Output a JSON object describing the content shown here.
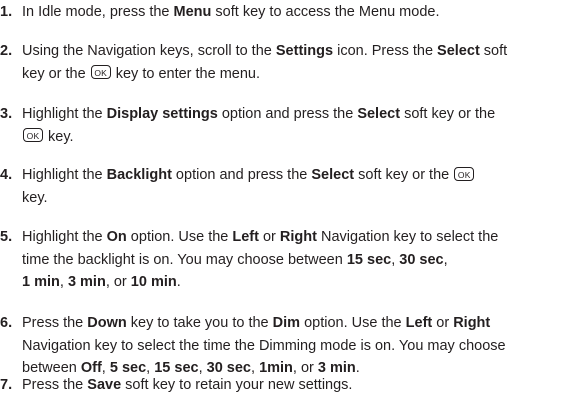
{
  "steps": [
    {
      "num": "1.",
      "lines": [
        [
          {
            "t": "In Idle mode, press the "
          },
          {
            "b": "Menu"
          },
          {
            "t": " soft key to access the Menu mode."
          }
        ]
      ]
    },
    {
      "num": "2.",
      "lines": [
        [
          {
            "t": "Using the Navigation keys, scroll to the "
          },
          {
            "b": "Settings"
          },
          {
            "t": " icon. Press the "
          },
          {
            "b": "Select"
          },
          {
            "t": " soft"
          }
        ],
        [
          {
            "t": "key or the "
          },
          {
            "k": "OK"
          },
          {
            "t": " key to enter the menu."
          }
        ]
      ]
    },
    {
      "num": "3.",
      "lines": [
        [
          {
            "t": "Highlight the "
          },
          {
            "b": "Display settings"
          },
          {
            "t": " option and press the "
          },
          {
            "b": "Select"
          },
          {
            "t": " soft key or the"
          }
        ],
        [
          {
            "k": "OK"
          },
          {
            "t": " key."
          }
        ]
      ]
    },
    {
      "num": "4.",
      "lines": [
        [
          {
            "t": "Highlight the "
          },
          {
            "b": "Backlight"
          },
          {
            "t": " option and press the "
          },
          {
            "b": "Select"
          },
          {
            "t": " soft key or the "
          },
          {
            "k": "OK"
          }
        ],
        [
          {
            "t": "key."
          }
        ]
      ]
    },
    {
      "num": "5.",
      "lines": [
        [
          {
            "t": "Highlight the "
          },
          {
            "b": "On"
          },
          {
            "t": " option. Use the "
          },
          {
            "b": "Left"
          },
          {
            "t": " or "
          },
          {
            "b": "Right"
          },
          {
            "t": " Navigation key to select the"
          }
        ],
        [
          {
            "t": "time the backlight is on. You may choose between "
          },
          {
            "b": "15 sec"
          },
          {
            "t": ", "
          },
          {
            "b": "30 sec"
          },
          {
            "t": ","
          }
        ],
        [
          {
            "b": "1 min"
          },
          {
            "t": ", "
          },
          {
            "b": "3 min"
          },
          {
            "t": ", or "
          },
          {
            "b": "10 min"
          },
          {
            "t": "."
          }
        ]
      ]
    },
    {
      "num": "6.",
      "lines": [
        [
          {
            "t": "Press the "
          },
          {
            "b": "Down"
          },
          {
            "t": " key to take you to the "
          },
          {
            "b": "Dim"
          },
          {
            "t": " option. Use the "
          },
          {
            "b": "Left"
          },
          {
            "t": " or "
          },
          {
            "b": "Right"
          }
        ],
        [
          {
            "t": "Navigation key to select the time the Dimming mode is on. You may choose"
          }
        ],
        [
          {
            "t": "between "
          },
          {
            "b": "Off"
          },
          {
            "t": ", "
          },
          {
            "b": "5 sec"
          },
          {
            "t": ", "
          },
          {
            "b": "15 sec"
          },
          {
            "t": ", "
          },
          {
            "b": "30 sec"
          },
          {
            "t": ", "
          },
          {
            "b": "1min"
          },
          {
            "t": ", or "
          },
          {
            "b": "3 min"
          },
          {
            "t": "."
          }
        ]
      ]
    },
    {
      "num": "7.",
      "lines": [
        [
          {
            "t": "Press the "
          },
          {
            "b": "Save"
          },
          {
            "t": " soft key to retain your new settings."
          }
        ]
      ]
    }
  ]
}
